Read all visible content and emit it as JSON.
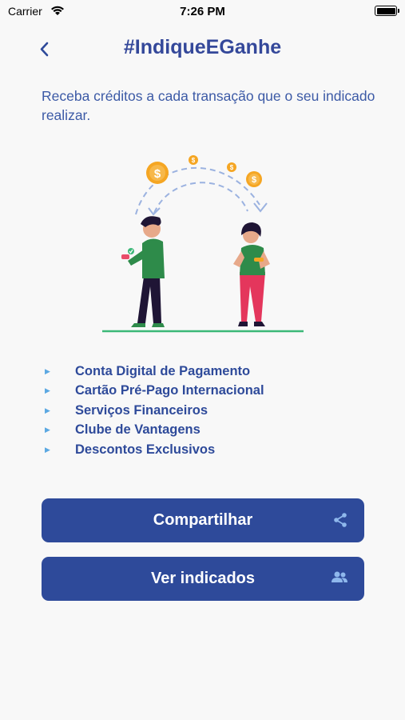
{
  "status_bar": {
    "carrier": "Carrier",
    "time": "7:26 PM"
  },
  "header": {
    "title": "#IndiqueEGanhe",
    "back_icon": "chevron-left-icon"
  },
  "description": "Receba créditos a cada transação que o seu indicado realizar.",
  "benefits": [
    "Conta Digital de Pagamento",
    "Cartão Pré-Pago Internacional",
    "Serviços Financeiros",
    "Clube de Vantagens",
    "Descontos Exclusivos"
  ],
  "actions": {
    "share_label": "Compartilhar",
    "share_icon": "share-icon",
    "referrals_label": "Ver indicados",
    "referrals_icon": "people-icon"
  },
  "colors": {
    "primary": "#2e4a9a",
    "accent": "#5ba8e2",
    "background": "#f8f8f8",
    "coin": "#f5a623"
  }
}
